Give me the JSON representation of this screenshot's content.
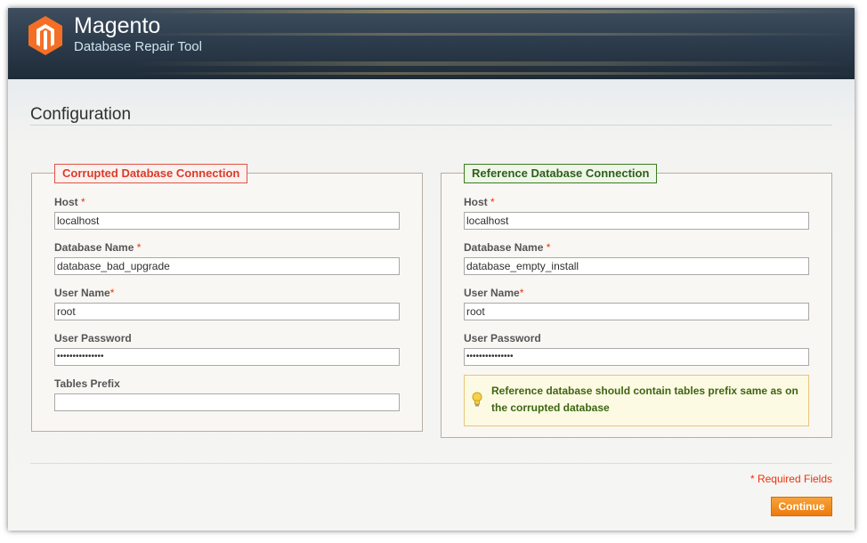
{
  "header": {
    "brand": "Magento",
    "subtitle": "Database Repair Tool"
  },
  "page": {
    "title": "Configuration"
  },
  "corrupted": {
    "legend": "Corrupted Database Connection",
    "host_label": "Host",
    "host_value": "localhost",
    "dbname_label": "Database Name",
    "dbname_value": "database_bad_upgrade",
    "user_label": "User Name",
    "user_value": "root",
    "password_label": "User Password",
    "password_value": "•••••••••••••••",
    "prefix_label": "Tables Prefix",
    "prefix_value": ""
  },
  "reference": {
    "legend": "Reference Database Connection",
    "host_label": "Host",
    "host_value": "localhost",
    "dbname_label": "Database Name",
    "dbname_value": "database_empty_install",
    "user_label": "User Name",
    "user_value": "root",
    "password_label": "User Password",
    "password_value": "•••••••••••••••",
    "notice": "Reference database should contain tables prefix same as on the corrupted database"
  },
  "required_marker": "*",
  "footer": {
    "required_note": "* Required Fields",
    "continue_label": "Continue"
  },
  "colors": {
    "header_bg": "#2e3d4d",
    "brand_orange": "#f46f25",
    "required_red": "#eb340a",
    "corrupted_legend": "#db3b2a",
    "reference_legend": "#2f5e1c",
    "button": "#ee7a0c"
  },
  "icons": {
    "logo": "magento-logo-icon",
    "notice": "lightbulb-icon"
  }
}
